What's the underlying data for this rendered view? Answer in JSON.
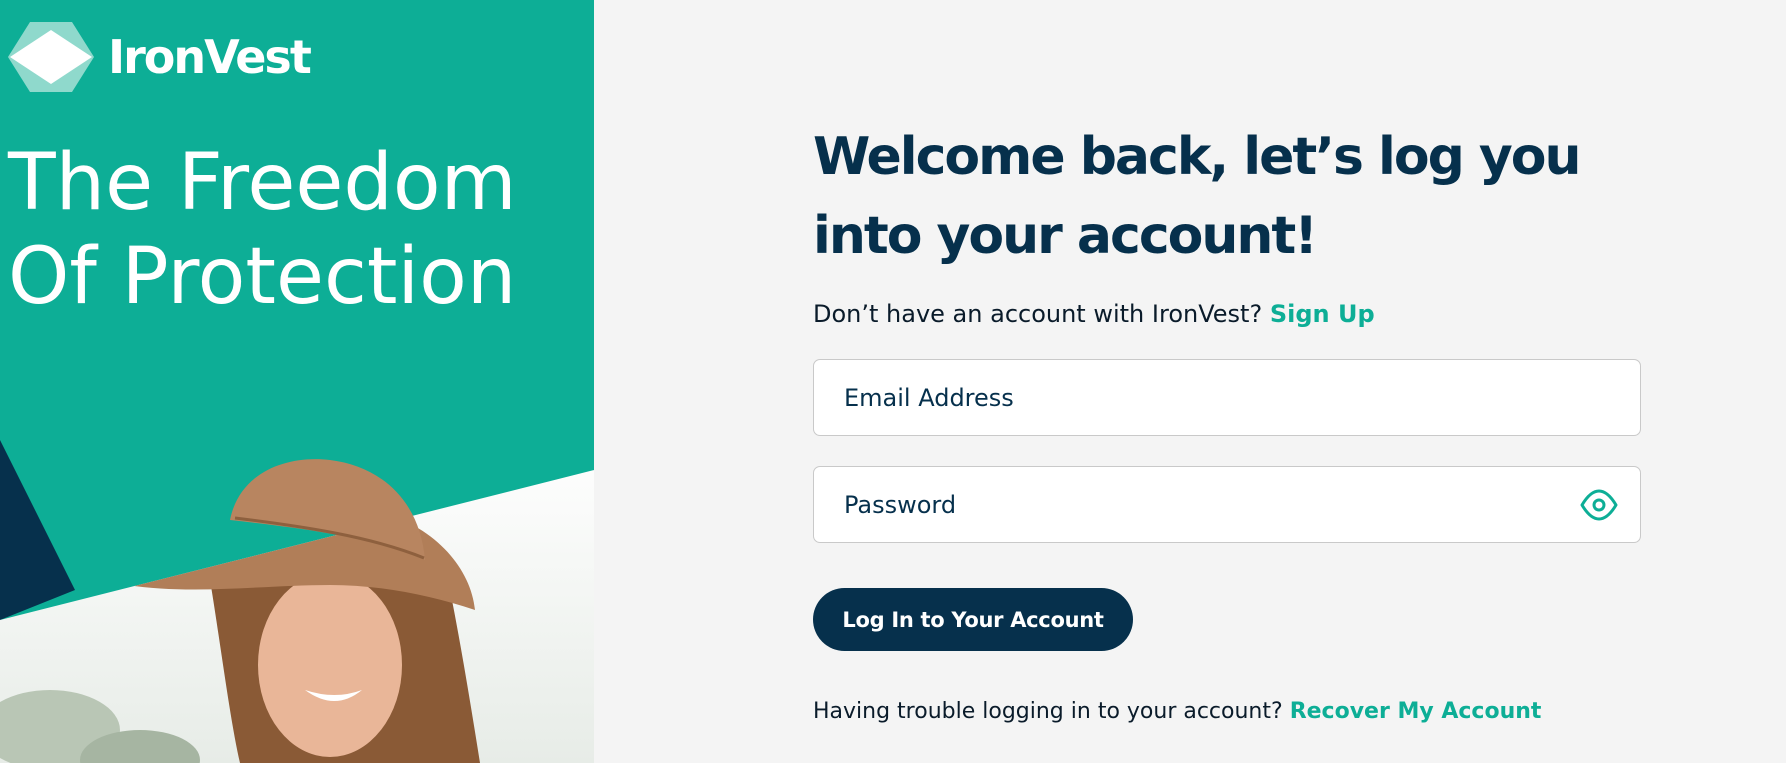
{
  "brand": {
    "name": "IronVest",
    "logo_icon": "ironvest-logo-icon",
    "tagline_line1": "The Freedom",
    "tagline_line2": "Of Protection",
    "colors": {
      "teal": "#0dae96",
      "navy": "#06304c"
    }
  },
  "login": {
    "heading_line1": "Welcome back, let’s log you",
    "heading_line2": "into your account!",
    "signup_prompt": "Don’t have an account with IronVest?",
    "signup_link": "Sign Up",
    "email_placeholder": "Email Address",
    "email_value": "",
    "password_placeholder": "Password",
    "password_value": "",
    "password_toggle_icon": "eye-icon",
    "submit_label": "Log In to Your Account",
    "recover_prompt": "Having trouble logging in to your account?",
    "recover_link": "Recover My Account"
  }
}
